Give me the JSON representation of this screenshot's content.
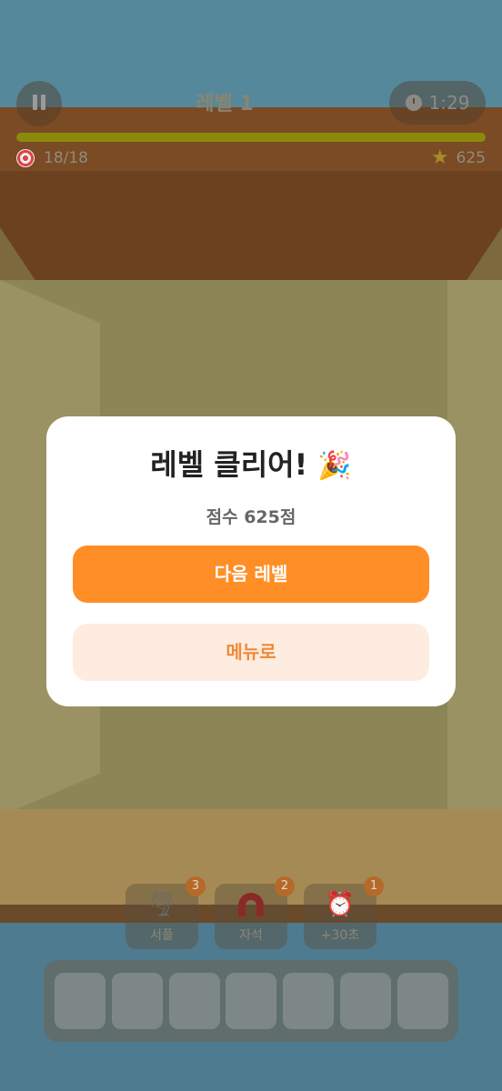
{
  "hud": {
    "level_title": "레벨 1",
    "timer": "1:29",
    "progress_fraction": 1.0,
    "target_count": "18/18",
    "score": "625",
    "icons": {
      "pause": "pause-icon",
      "clock": "clock-icon",
      "target": "target-icon",
      "star": "star-icon"
    }
  },
  "modal": {
    "title": "레벨 클리어!",
    "title_emoji": "🎉",
    "score_text": "점수 625점",
    "next_button": "다음 레벨",
    "menu_button": "메뉴로"
  },
  "boosters": [
    {
      "label": "서플",
      "count": "3",
      "icon": "tornado-icon"
    },
    {
      "label": "자석",
      "count": "2",
      "icon": "magnet-icon"
    },
    {
      "label": "+30초",
      "count": "1",
      "icon": "alarm-clock-icon"
    }
  ],
  "tray": {
    "slots": 7
  },
  "colors": {
    "accent": "#ff8e26",
    "menu_bg": "#ffece0",
    "menu_text": "#ee8a3a"
  }
}
